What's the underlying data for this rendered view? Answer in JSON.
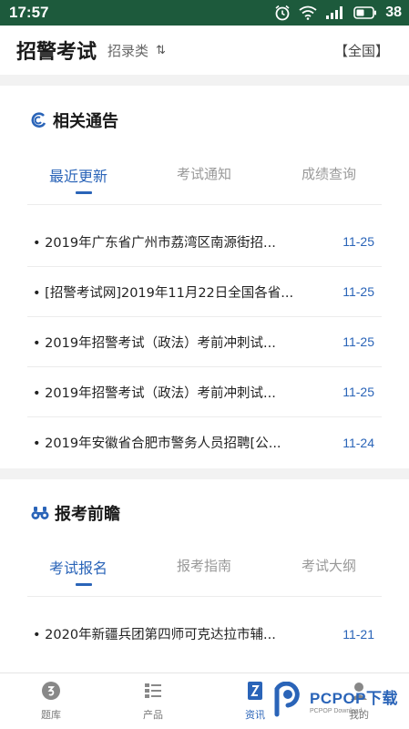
{
  "status_bar": {
    "time": "17:57",
    "battery": "38"
  },
  "header": {
    "title": "招警考试",
    "category": "招录类",
    "region": "【全国】"
  },
  "notices": {
    "title": "相关通告",
    "tabs": [
      "最近更新",
      "考试通知",
      "成绩查询"
    ],
    "items": [
      {
        "text": "• 2019年广东省广州市荔湾区南源街招...",
        "date": "11-25"
      },
      {
        "text": "• [招警考试网]2019年11月22日全国各省...",
        "date": "11-25"
      },
      {
        "text": "• 2019年招警考试（政法）考前冲刺试...",
        "date": "11-25"
      },
      {
        "text": "• 2019年招警考试（政法）考前冲刺试...",
        "date": "11-25"
      },
      {
        "text": "• 2019年安徽省合肥市警务人员招聘[公...",
        "date": "11-24"
      }
    ]
  },
  "outlook": {
    "title": "报考前瞻",
    "tabs": [
      "考试报名",
      "报考指南",
      "考试大纲"
    ],
    "items": [
      {
        "text": "• 2020年新疆兵团第四师可克达拉市辅...",
        "date": "11-21"
      }
    ]
  },
  "bottom_nav": [
    {
      "label": "题库",
      "icon": "question-bank-icon"
    },
    {
      "label": "产品",
      "icon": "list-icon"
    },
    {
      "label": "资讯",
      "icon": "news-icon"
    },
    {
      "label": "我的",
      "icon": "profile-icon"
    }
  ],
  "watermark": {
    "main": "PCPOP下载",
    "sub": "PCPOP Download"
  },
  "colors": {
    "status_bar": "#1d5a3c",
    "accent": "#2a64b8"
  }
}
